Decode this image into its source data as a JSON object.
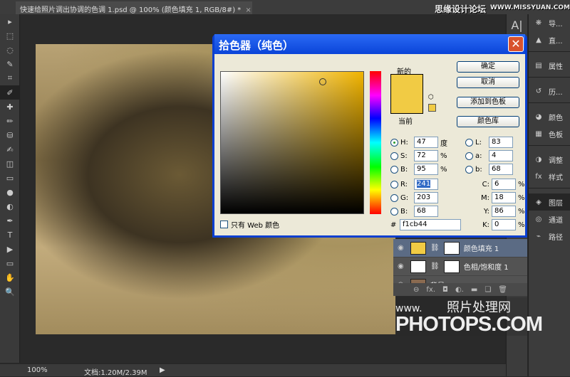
{
  "document_tab": {
    "title": "快速给照片调出协调的色调 1.psd @ 100% (颜色填充 1, RGB/8#) *",
    "close": "×"
  },
  "watermark_top": {
    "cn": "思缘设计论坛",
    "url": "WWW.MISSYUAN.COM"
  },
  "tools": [
    "move",
    "marquee",
    "lasso",
    "quick-select",
    "crop",
    "eyedropper",
    "healing",
    "brush",
    "stamp",
    "history-brush",
    "eraser",
    "gradient",
    "blur",
    "dodge",
    "pen",
    "type",
    "path-select",
    "shape",
    "hand",
    "zoom"
  ],
  "tool_glyphs": [
    "▸",
    "⬚",
    "◌",
    "✎",
    "⌗",
    "✐",
    "✚",
    "✏",
    "⛁",
    "✍",
    "◫",
    "▭",
    "●",
    "◐",
    "✒",
    "T",
    "▶",
    "▭",
    "✋",
    "🔍"
  ],
  "status": {
    "zoom": "100%",
    "doc": "文档:1.20M/2.39M",
    "arrow": "▶"
  },
  "panels": [
    {
      "label": "导...",
      "icon": "❋"
    },
    {
      "label": "直...",
      "icon": "▲"
    },
    {
      "label": "属性",
      "icon": "▤"
    },
    {
      "label": "历...",
      "icon": "↺"
    },
    {
      "label": "颜色",
      "icon": "◕"
    },
    {
      "label": "色板",
      "icon": "▦"
    },
    {
      "label": "调整",
      "icon": "◑"
    },
    {
      "label": "样式",
      "icon": "fx"
    },
    {
      "label": "图层",
      "icon": "◈"
    },
    {
      "label": "通道",
      "icon": "◎"
    },
    {
      "label": "路径",
      "icon": "⌁"
    }
  ],
  "dialog": {
    "title": "拾色器（纯色）",
    "close": "✕",
    "new_label": "新的",
    "current_label": "当前",
    "new_color": "#f1cb44",
    "buttons": {
      "ok": "确定",
      "cancel": "取消",
      "add_swatch": "添加到色板",
      "libraries": "颜色库"
    },
    "web_only": "只有 Web 颜色",
    "hsb": [
      {
        "label": "H:",
        "value": "47",
        "unit": "度",
        "selected": true
      },
      {
        "label": "S:",
        "value": "72",
        "unit": "%"
      },
      {
        "label": "B:",
        "value": "95",
        "unit": "%"
      }
    ],
    "rgb": [
      {
        "label": "R:",
        "value": "241"
      },
      {
        "label": "G:",
        "value": "203"
      },
      {
        "label": "B:",
        "value": "68"
      }
    ],
    "lab": [
      {
        "label": "L:",
        "value": "83"
      },
      {
        "label": "a:",
        "value": "4"
      },
      {
        "label": "b:",
        "value": "68"
      }
    ],
    "cmyk": [
      {
        "label": "C:",
        "value": "6",
        "unit": "%"
      },
      {
        "label": "M:",
        "value": "18",
        "unit": "%"
      },
      {
        "label": "Y:",
        "value": "86",
        "unit": "%"
      },
      {
        "label": "K:",
        "value": "0",
        "unit": "%"
      }
    ],
    "hex_label": "#",
    "hex": "f1cb44"
  },
  "layers": [
    {
      "name": "颜色填充 1",
      "selected": true
    },
    {
      "name": "色相/饱和度 1"
    },
    {
      "name": "背景"
    }
  ],
  "layer_footer": [
    "⊖",
    "fx.",
    "◘",
    "◐.",
    "▬",
    "❏",
    "🗑"
  ],
  "watermark_bottom": {
    "www": "www.",
    "cn": "照片处理网",
    "brand": "PHOTOPS.COM"
  }
}
